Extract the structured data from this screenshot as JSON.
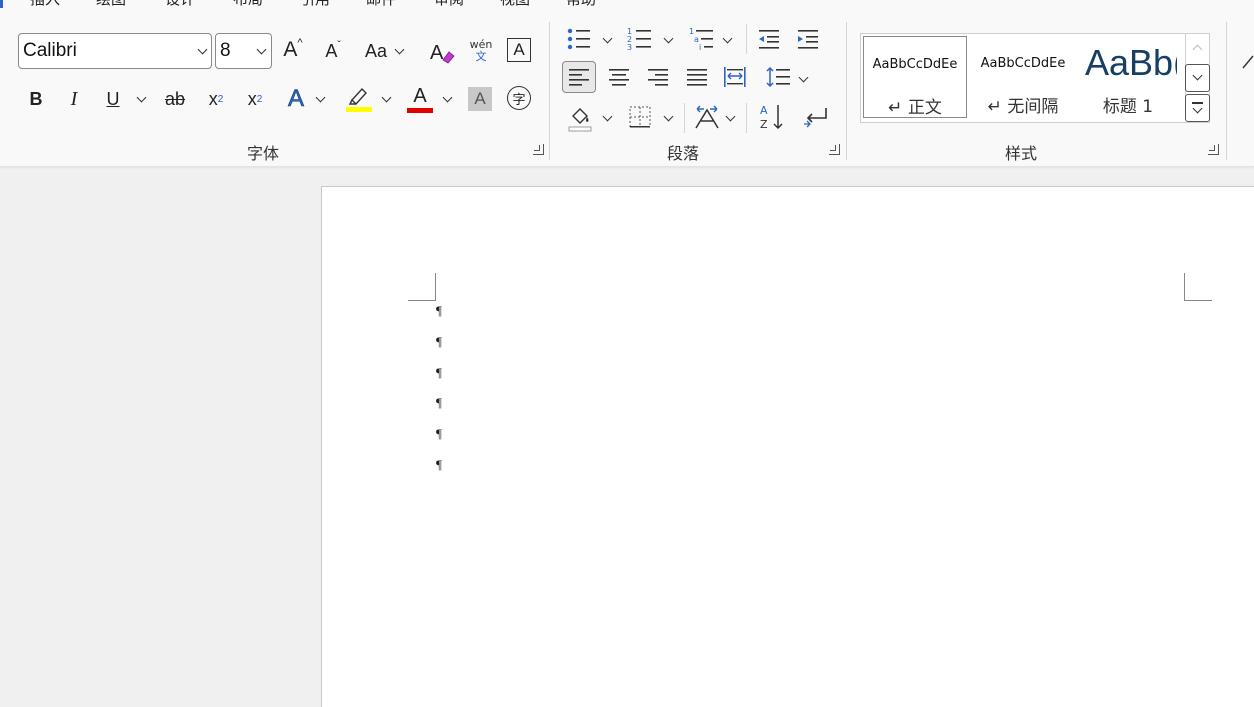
{
  "tabs": [
    "插入",
    "绘图",
    "设计",
    "布局",
    "引用",
    "邮件",
    "审阅",
    "视图",
    "帮助"
  ],
  "font": {
    "name_value": "Calibri",
    "size_value": "8",
    "grow_label": "A",
    "shrink_label": "A",
    "case_label": "Aa",
    "phonetic_top": "wén",
    "phonetic_bottom": "文",
    "border_char_label": "A",
    "bold_label": "B",
    "italic_label": "I",
    "underline_label": "U",
    "strike_label": "ab",
    "subscript_label": "x",
    "subscript_sub": "2",
    "superscript_label": "x",
    "superscript_sup": "2",
    "effects_label": "A",
    "font_color_label": "A",
    "shading_label": "A",
    "enclose_label": "字",
    "group_label": "字体",
    "highlight_color": "#ffff00",
    "font_color": "#e00000"
  },
  "paragraph": {
    "group_label": "段落"
  },
  "styles": {
    "group_label": "样式",
    "items": [
      {
        "sample": "AaBbCcDdEe",
        "name": "↵ 正文"
      },
      {
        "sample": "AaBbCcDdEe",
        "name": "↵ 无间隔"
      },
      {
        "sample": "AaBb(",
        "name": "标题 1"
      }
    ]
  },
  "document": {
    "paragraph_marks": [
      "¶",
      "¶",
      "¶",
      "¶",
      "¶",
      "¶"
    ]
  },
  "colors": {
    "accent_blue": "#2b65c8",
    "title_color": "#173e63"
  }
}
